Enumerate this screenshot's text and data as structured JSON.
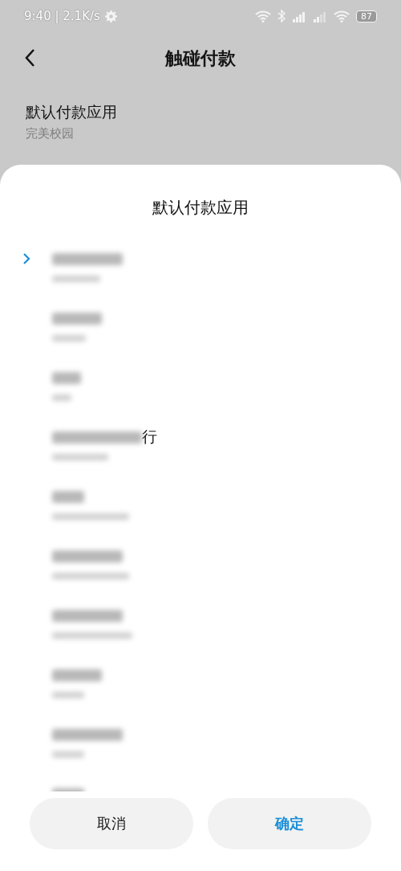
{
  "status_bar": {
    "time": "9:40 | 2.1K/s",
    "battery": "87"
  },
  "header": {
    "title": "触碰付款"
  },
  "setting": {
    "label": "默认付款应用",
    "value": "完美校园"
  },
  "sheet": {
    "title": "默认付款应用",
    "options": [
      {
        "selected": true
      },
      {
        "selected": false
      },
      {
        "selected": false
      },
      {
        "selected": false,
        "visible_text": "行"
      },
      {
        "selected": false
      },
      {
        "selected": false
      },
      {
        "selected": false
      },
      {
        "selected": false
      },
      {
        "selected": false
      },
      {
        "selected": false
      }
    ],
    "buttons": [
      {
        "label": "取消",
        "kind": "cancel"
      },
      {
        "label": "确定",
        "kind": "confirm"
      }
    ]
  }
}
